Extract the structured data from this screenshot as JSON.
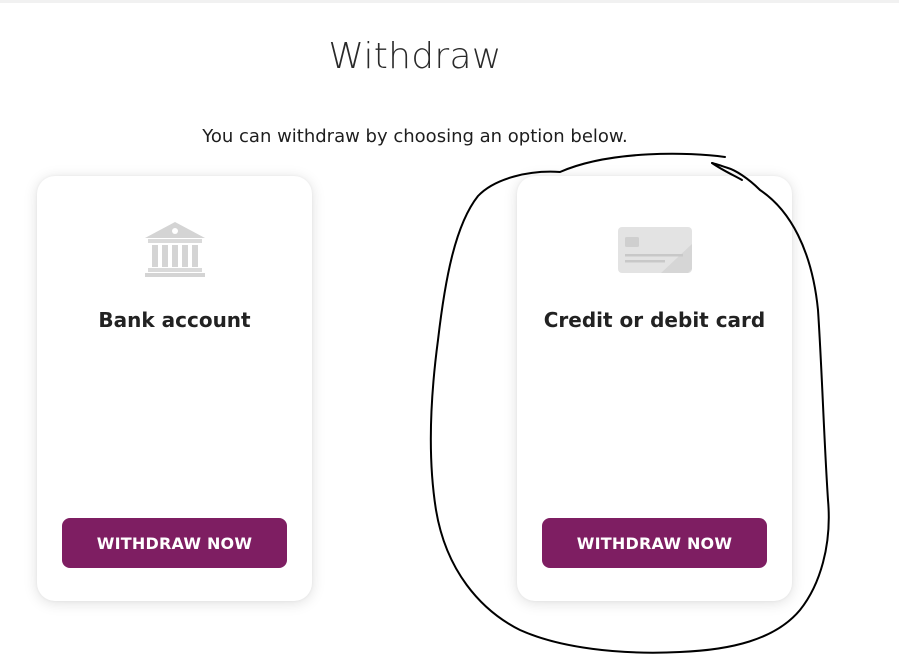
{
  "page": {
    "title": "Withdraw",
    "subtitle": "You can withdraw by choosing an option below."
  },
  "options": [
    {
      "icon": "bank-icon",
      "label": "Bank account",
      "button_label": "WITHDRAW NOW"
    },
    {
      "icon": "credit-card-icon",
      "label": "Credit or debit card",
      "button_label": "WITHDRAW NOW"
    }
  ],
  "colors": {
    "brand_button": "#7e1e62",
    "icon_gray": "#d9d9d9",
    "annotation_stroke": "#000000"
  }
}
